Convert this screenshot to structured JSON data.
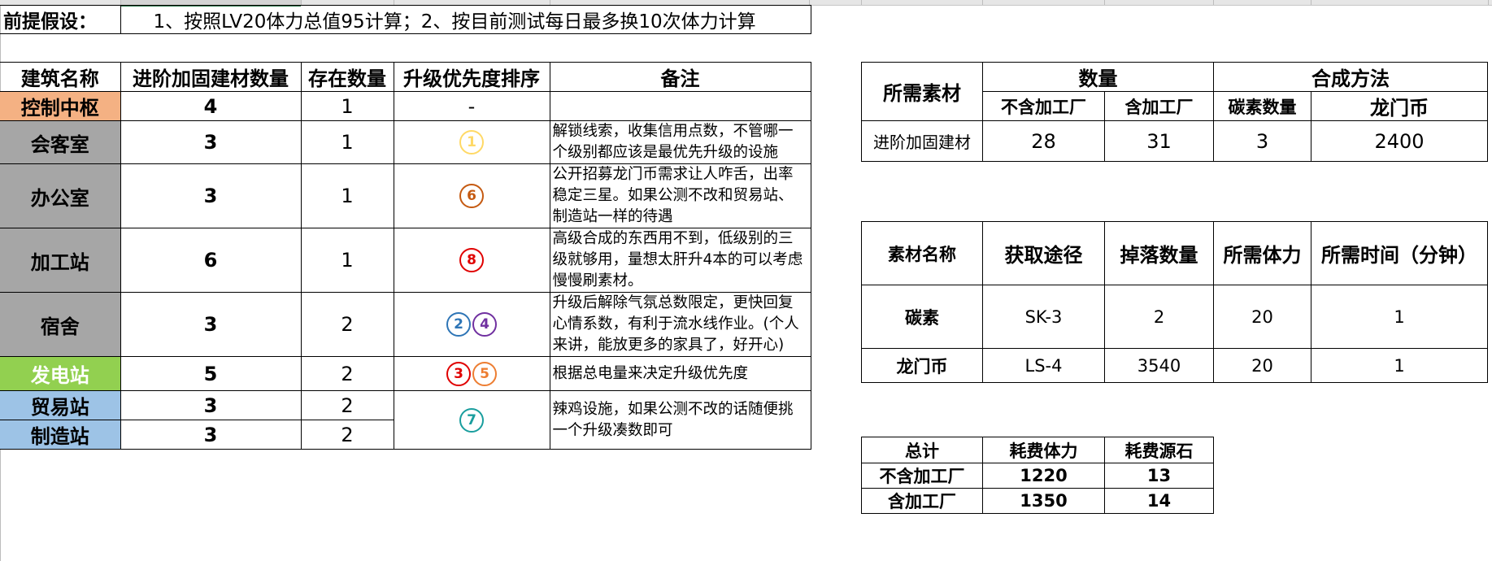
{
  "premise": {
    "label": "前提假设：",
    "text": "1、按照LV20体力总值95计算；2、按目前测试每日最多换10次体力计算"
  },
  "buildings": {
    "headers": [
      "建筑名称",
      "进阶加固建材数量",
      "存在数量",
      "升级优先度排序",
      "备注"
    ],
    "rows": [
      {
        "name": "控制中枢",
        "materials": "4",
        "count": "1",
        "priority": [
          "-"
        ],
        "note": ""
      },
      {
        "name": "会客室",
        "materials": "3",
        "count": "1",
        "priority": [
          "1"
        ],
        "note": "解锁线索，收集信用点数，不管哪一个级别都应该是最优先升级的设施"
      },
      {
        "name": "办公室",
        "materials": "3",
        "count": "1",
        "priority": [
          "6"
        ],
        "note": "公开招募龙门币需求让人咋舌，出率稳定三星。如果公测不改和贸易站、制造站一样的待遇"
      },
      {
        "name": "加工站",
        "materials": "6",
        "count": "1",
        "priority": [
          "8"
        ],
        "note": "高级合成的东西用不到，低级别的三级就够用，量想太肝升4本的可以考虑慢慢刷素材。"
      },
      {
        "name": "宿舍",
        "materials": "3",
        "count": "2",
        "priority": [
          "2",
          "4"
        ],
        "note": "升级后解除气氛总数限定，更快回复心情系数，有利于流水线作业。(个人来讲，能放更多的家具了，好开心)"
      },
      {
        "name": "发电站",
        "materials": "5",
        "count": "2",
        "priority": [
          "3",
          "5"
        ],
        "note": "根据总电量来决定升级优先度"
      },
      {
        "name": "贸易站",
        "materials": "3",
        "count": "2"
      },
      {
        "name": "制造站",
        "materials": "3",
        "count": "2"
      }
    ],
    "shared": {
      "priority": [
        "7"
      ],
      "note": "辣鸡设施，如果公测不改的话随便挑一个升级凑数即可"
    }
  },
  "required": {
    "h_material": "所需素材",
    "h_qty": "数量",
    "h_method": "合成方法",
    "h_no_factory": "不含加工厂",
    "h_factory": "含加工厂",
    "h_carbon": "碳素数量",
    "h_coin": "龙门币",
    "row": {
      "name": "进阶加固建材",
      "no_factory": "28",
      "factory": "31",
      "carbon": "3",
      "coin": "2400"
    }
  },
  "materials": {
    "headers": [
      "素材名称",
      "获取途径",
      "掉落数量",
      "所需体力",
      "所需时间（分钟）"
    ],
    "rows": [
      [
        "碳素",
        "SK-3",
        "2",
        "20",
        "1"
      ],
      [
        "龙门币",
        "LS-4",
        "3540",
        "20",
        "1"
      ]
    ]
  },
  "totals": {
    "headers": [
      "总计",
      "耗费体力",
      "耗费源石"
    ],
    "rows": [
      [
        "不含加工厂",
        "1220",
        "13"
      ],
      [
        "含加工厂",
        "1350",
        "14"
      ]
    ]
  },
  "colors": {
    "orange": "#f4b183",
    "gray": "#a6a6a6",
    "green": "#92d050",
    "blue": "#9dc3e6"
  }
}
